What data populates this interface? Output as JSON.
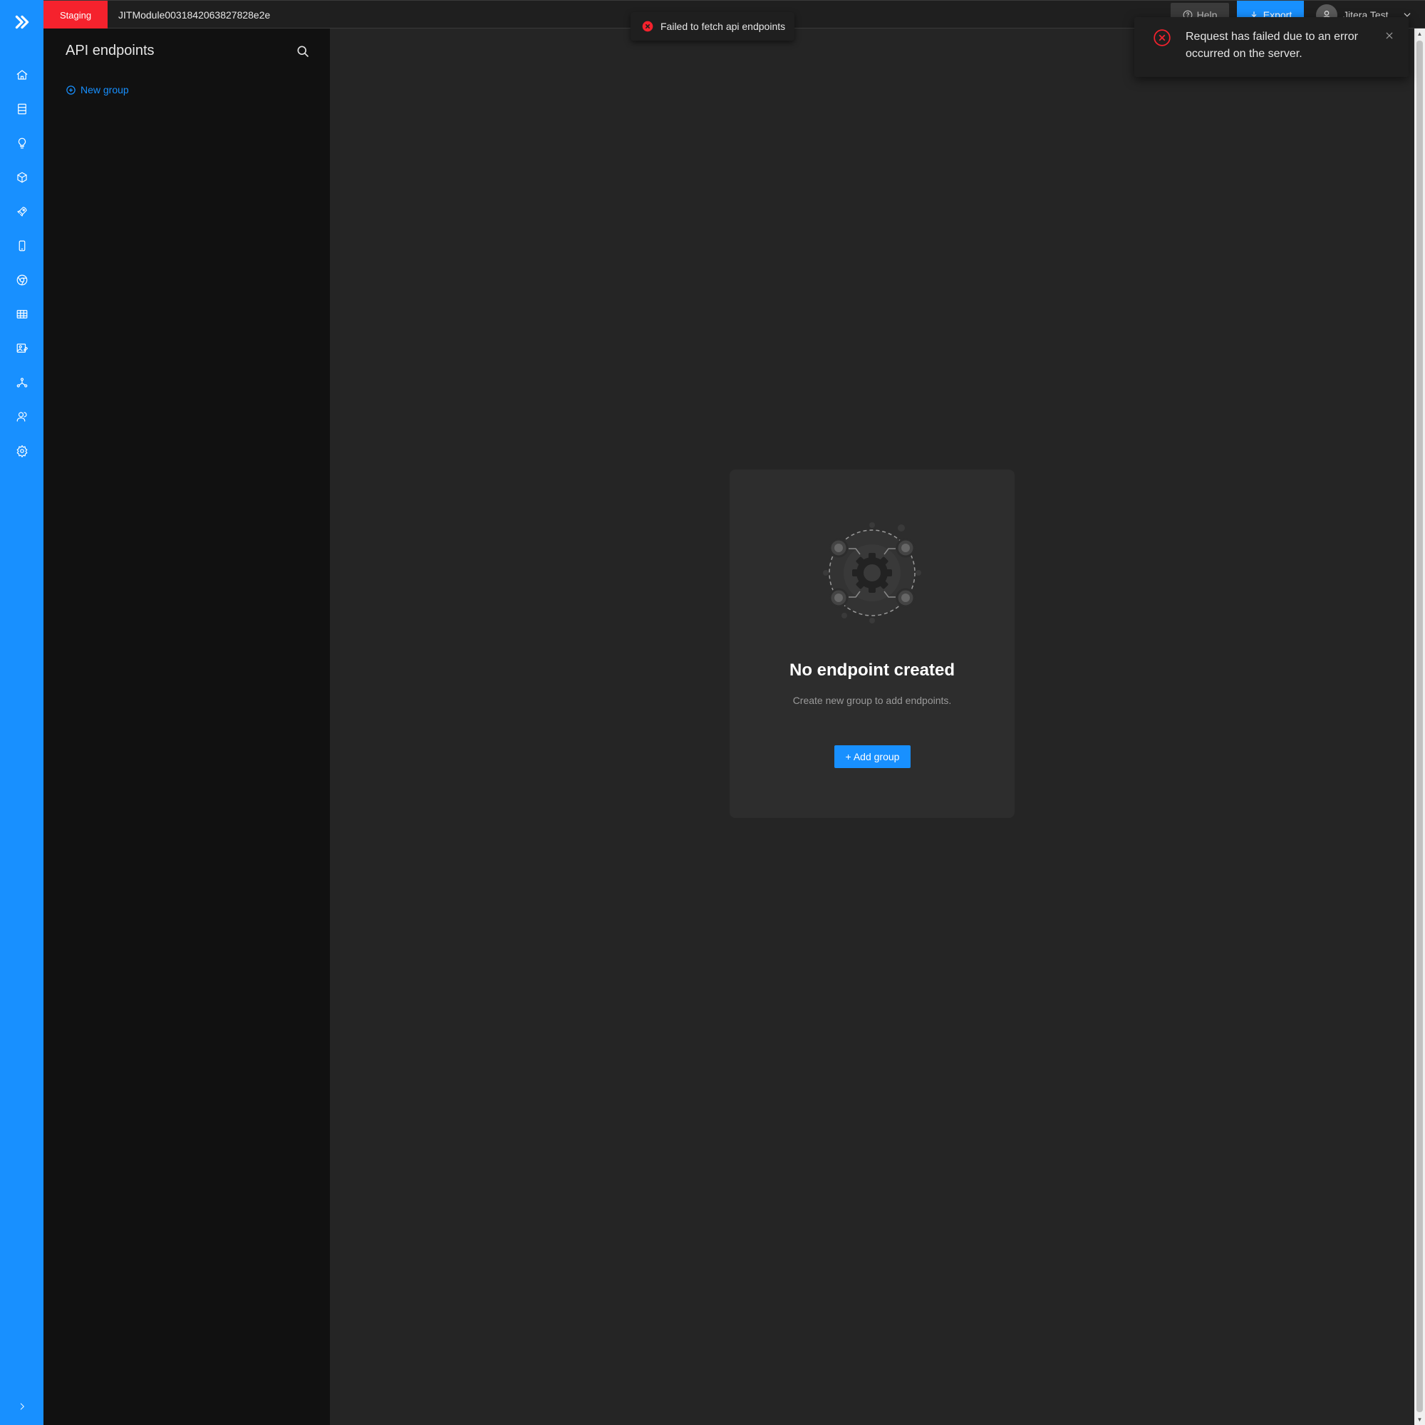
{
  "header": {
    "environment": "Staging",
    "project_name": "JITModule0031842063827828e2e",
    "help_label": "Help",
    "export_label": "Export",
    "user_name": "Jitera Test..."
  },
  "rail": {
    "items": [
      "home-icon",
      "database-icon",
      "lightbulb-icon",
      "package-icon",
      "rocket-icon",
      "mobile-icon",
      "chrome-icon",
      "table-icon",
      "image-edit-icon",
      "network-icon",
      "users-icon",
      "gear-icon"
    ]
  },
  "panel": {
    "title": "API endpoints",
    "new_group_label": "New group"
  },
  "empty_state": {
    "title": "No endpoint created",
    "subtitle": "Create new group to add endpoints.",
    "button_label": "+ Add group"
  },
  "toast": {
    "message": "Failed to fetch api endpoints"
  },
  "notification": {
    "message": "Request has failed due to an error occurred on the server."
  },
  "colors": {
    "accent": "#1890ff",
    "danger": "#f5222d",
    "panel_bg": "#111111",
    "main_bg": "#252525"
  }
}
